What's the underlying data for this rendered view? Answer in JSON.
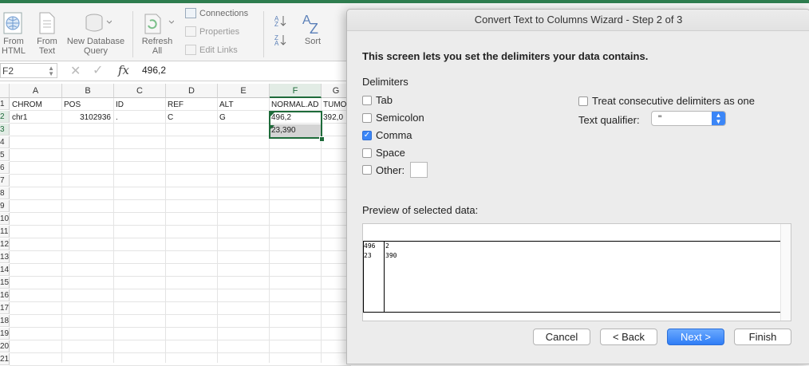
{
  "ribbon": {
    "from_html": "From\nHTML",
    "from_html_1": "From",
    "from_html_2": "HTML",
    "from_text_1": "From",
    "from_text_2": "Text",
    "new_db_1": "New Database",
    "new_db_2": "Query",
    "refresh_1": "Refresh",
    "refresh_2": "All",
    "connections": "Connections",
    "properties": "Properties",
    "edit_links": "Edit Links",
    "sort": "Sort"
  },
  "formula_bar": {
    "name_box": "F2",
    "fx": "fx",
    "value": "496,2"
  },
  "sheet": {
    "columns": [
      "A",
      "B",
      "C",
      "D",
      "E",
      "F",
      "G"
    ],
    "rows": [
      "1",
      "2",
      "3",
      "4",
      "5",
      "6",
      "7",
      "8",
      "9",
      "10",
      "11",
      "12",
      "13",
      "14",
      "15",
      "16",
      "17",
      "18",
      "19",
      "20",
      "21"
    ],
    "row_1": [
      "CHROM",
      "POS",
      "ID",
      "REF",
      "ALT",
      "NORMAL.AD",
      "TUMOR"
    ],
    "row_2": [
      "chr1",
      "3102936",
      ".",
      "C",
      "G",
      "496,2",
      "392,0"
    ],
    "row_3_f": "23,390"
  },
  "dialog": {
    "title": "Convert Text to Columns Wizard - Step 2 of 3",
    "instruction": "This screen lets you set the delimiters your data contains.",
    "delimiters_label": "Delimiters",
    "options": [
      {
        "label": "Tab",
        "checked": false
      },
      {
        "label": "Semicolon",
        "checked": false
      },
      {
        "label": "Comma",
        "checked": true
      },
      {
        "label": "Space",
        "checked": false
      },
      {
        "label": "Other:",
        "checked": false
      }
    ],
    "treat_consecutive": "Treat consecutive delimiters as one",
    "text_qualifier_label": "Text qualifier:",
    "text_qualifier_value": "\"",
    "preview_label": "Preview of selected data:",
    "preview_rows": [
      [
        "496",
        "2"
      ],
      [
        "23",
        "390"
      ]
    ],
    "buttons": {
      "cancel": "Cancel",
      "back": "< Back",
      "next": "Next >",
      "finish": "Finish"
    }
  },
  "colors": {
    "excel_green": "#1e6b3a",
    "accent_blue": "#3b86f7"
  }
}
